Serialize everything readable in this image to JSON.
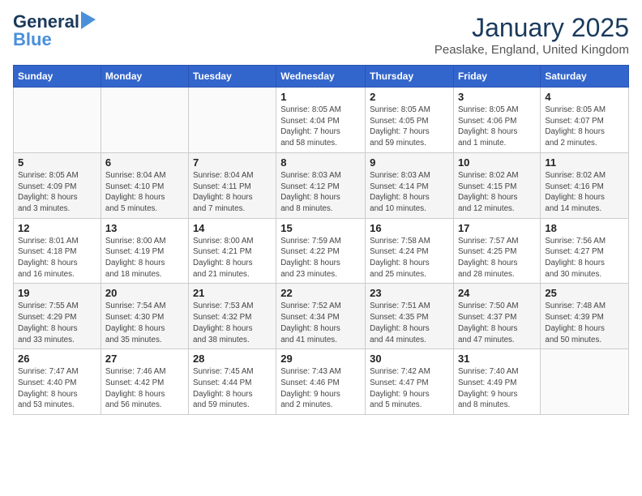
{
  "logo": {
    "line1": "General",
    "line2": "Blue"
  },
  "title": "January 2025",
  "subtitle": "Peaslake, England, United Kingdom",
  "weekdays": [
    "Sunday",
    "Monday",
    "Tuesday",
    "Wednesday",
    "Thursday",
    "Friday",
    "Saturday"
  ],
  "weeks": [
    [
      {
        "day": "",
        "info": ""
      },
      {
        "day": "",
        "info": ""
      },
      {
        "day": "",
        "info": ""
      },
      {
        "day": "1",
        "info": "Sunrise: 8:05 AM\nSunset: 4:04 PM\nDaylight: 7 hours\nand 58 minutes."
      },
      {
        "day": "2",
        "info": "Sunrise: 8:05 AM\nSunset: 4:05 PM\nDaylight: 7 hours\nand 59 minutes."
      },
      {
        "day": "3",
        "info": "Sunrise: 8:05 AM\nSunset: 4:06 PM\nDaylight: 8 hours\nand 1 minute."
      },
      {
        "day": "4",
        "info": "Sunrise: 8:05 AM\nSunset: 4:07 PM\nDaylight: 8 hours\nand 2 minutes."
      }
    ],
    [
      {
        "day": "5",
        "info": "Sunrise: 8:05 AM\nSunset: 4:09 PM\nDaylight: 8 hours\nand 3 minutes."
      },
      {
        "day": "6",
        "info": "Sunrise: 8:04 AM\nSunset: 4:10 PM\nDaylight: 8 hours\nand 5 minutes."
      },
      {
        "day": "7",
        "info": "Sunrise: 8:04 AM\nSunset: 4:11 PM\nDaylight: 8 hours\nand 7 minutes."
      },
      {
        "day": "8",
        "info": "Sunrise: 8:03 AM\nSunset: 4:12 PM\nDaylight: 8 hours\nand 8 minutes."
      },
      {
        "day": "9",
        "info": "Sunrise: 8:03 AM\nSunset: 4:14 PM\nDaylight: 8 hours\nand 10 minutes."
      },
      {
        "day": "10",
        "info": "Sunrise: 8:02 AM\nSunset: 4:15 PM\nDaylight: 8 hours\nand 12 minutes."
      },
      {
        "day": "11",
        "info": "Sunrise: 8:02 AM\nSunset: 4:16 PM\nDaylight: 8 hours\nand 14 minutes."
      }
    ],
    [
      {
        "day": "12",
        "info": "Sunrise: 8:01 AM\nSunset: 4:18 PM\nDaylight: 8 hours\nand 16 minutes."
      },
      {
        "day": "13",
        "info": "Sunrise: 8:00 AM\nSunset: 4:19 PM\nDaylight: 8 hours\nand 18 minutes."
      },
      {
        "day": "14",
        "info": "Sunrise: 8:00 AM\nSunset: 4:21 PM\nDaylight: 8 hours\nand 21 minutes."
      },
      {
        "day": "15",
        "info": "Sunrise: 7:59 AM\nSunset: 4:22 PM\nDaylight: 8 hours\nand 23 minutes."
      },
      {
        "day": "16",
        "info": "Sunrise: 7:58 AM\nSunset: 4:24 PM\nDaylight: 8 hours\nand 25 minutes."
      },
      {
        "day": "17",
        "info": "Sunrise: 7:57 AM\nSunset: 4:25 PM\nDaylight: 8 hours\nand 28 minutes."
      },
      {
        "day": "18",
        "info": "Sunrise: 7:56 AM\nSunset: 4:27 PM\nDaylight: 8 hours\nand 30 minutes."
      }
    ],
    [
      {
        "day": "19",
        "info": "Sunrise: 7:55 AM\nSunset: 4:29 PM\nDaylight: 8 hours\nand 33 minutes."
      },
      {
        "day": "20",
        "info": "Sunrise: 7:54 AM\nSunset: 4:30 PM\nDaylight: 8 hours\nand 35 minutes."
      },
      {
        "day": "21",
        "info": "Sunrise: 7:53 AM\nSunset: 4:32 PM\nDaylight: 8 hours\nand 38 minutes."
      },
      {
        "day": "22",
        "info": "Sunrise: 7:52 AM\nSunset: 4:34 PM\nDaylight: 8 hours\nand 41 minutes."
      },
      {
        "day": "23",
        "info": "Sunrise: 7:51 AM\nSunset: 4:35 PM\nDaylight: 8 hours\nand 44 minutes."
      },
      {
        "day": "24",
        "info": "Sunrise: 7:50 AM\nSunset: 4:37 PM\nDaylight: 8 hours\nand 47 minutes."
      },
      {
        "day": "25",
        "info": "Sunrise: 7:48 AM\nSunset: 4:39 PM\nDaylight: 8 hours\nand 50 minutes."
      }
    ],
    [
      {
        "day": "26",
        "info": "Sunrise: 7:47 AM\nSunset: 4:40 PM\nDaylight: 8 hours\nand 53 minutes."
      },
      {
        "day": "27",
        "info": "Sunrise: 7:46 AM\nSunset: 4:42 PM\nDaylight: 8 hours\nand 56 minutes."
      },
      {
        "day": "28",
        "info": "Sunrise: 7:45 AM\nSunset: 4:44 PM\nDaylight: 8 hours\nand 59 minutes."
      },
      {
        "day": "29",
        "info": "Sunrise: 7:43 AM\nSunset: 4:46 PM\nDaylight: 9 hours\nand 2 minutes."
      },
      {
        "day": "30",
        "info": "Sunrise: 7:42 AM\nSunset: 4:47 PM\nDaylight: 9 hours\nand 5 minutes."
      },
      {
        "day": "31",
        "info": "Sunrise: 7:40 AM\nSunset: 4:49 PM\nDaylight: 9 hours\nand 8 minutes."
      },
      {
        "day": "",
        "info": ""
      }
    ]
  ]
}
